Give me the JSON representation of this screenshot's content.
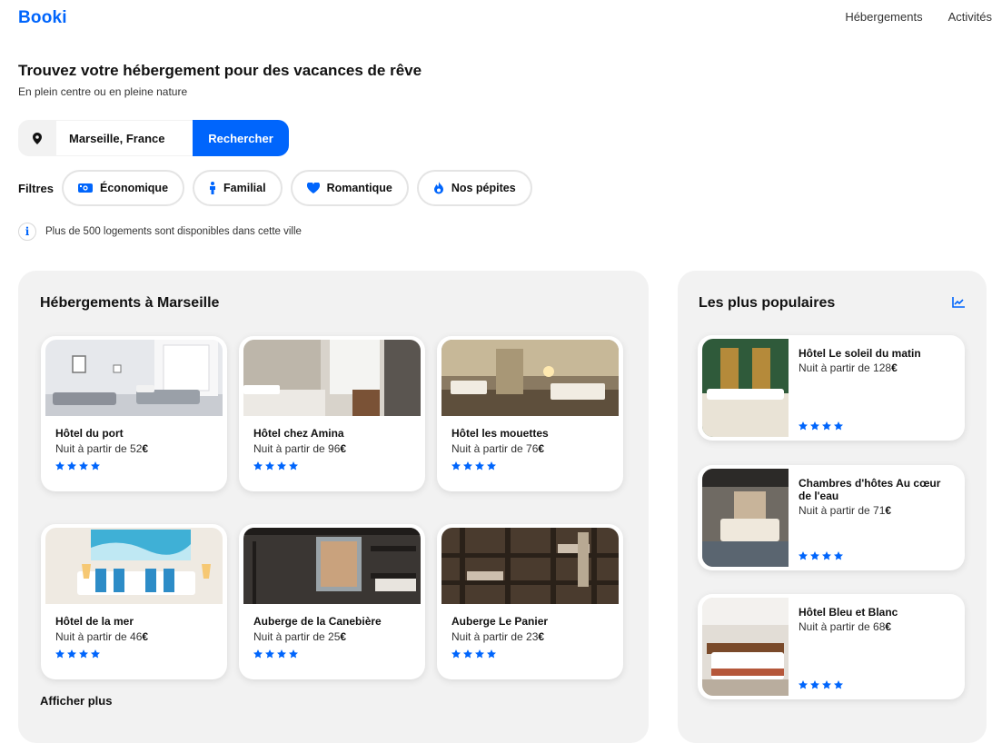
{
  "brand": {
    "logo": "Booki",
    "accent": "#0065FC"
  },
  "nav": {
    "items": [
      "Hébergements",
      "Activités"
    ]
  },
  "hero": {
    "title": "Trouvez votre hébergement pour des vacances de rêve",
    "subtitle": "En plein centre ou en pleine nature"
  },
  "search": {
    "icon": "location-pin-icon",
    "value": "Marseille, France",
    "button": "Rechercher"
  },
  "filters": {
    "label": "Filtres",
    "items": [
      {
        "label": "Économique",
        "icon": "money-icon"
      },
      {
        "label": "Familial",
        "icon": "person-icon"
      },
      {
        "label": "Romantique",
        "icon": "heart-icon"
      },
      {
        "label": "Nos pépites",
        "icon": "fire-icon"
      }
    ]
  },
  "info": {
    "icon": "info-icon",
    "text": "Plus de 500 logements sont disponibles dans cette ville"
  },
  "listings": {
    "title": "Hébergements à Marseille",
    "more": "Afficher plus",
    "price_prefix": "Nuit à partir de",
    "currency": "€",
    "items": [
      {
        "name": "Hôtel du port",
        "price": "52",
        "stars": 4
      },
      {
        "name": "Hôtel chez Amina",
        "price": "96",
        "stars": 4
      },
      {
        "name": "Hôtel les mouettes",
        "price": "76",
        "stars": 4
      },
      {
        "name": "Hôtel de la mer",
        "price": "46",
        "stars": 4
      },
      {
        "name": "Auberge de la Canebière",
        "price": "25",
        "stars": 4
      },
      {
        "name": "Auberge Le Panier",
        "price": "23",
        "stars": 4
      }
    ]
  },
  "popular": {
    "title": "Les plus populaires",
    "icon": "trending-chart-icon",
    "items": [
      {
        "name": "Hôtel Le soleil du matin",
        "price": "128",
        "stars": 4
      },
      {
        "name": "Chambres d'hôtes Au cœur de l'eau",
        "price": "71",
        "stars": 4
      },
      {
        "name": "Hôtel Bleu et Blanc",
        "price": "68",
        "stars": 4
      }
    ]
  }
}
